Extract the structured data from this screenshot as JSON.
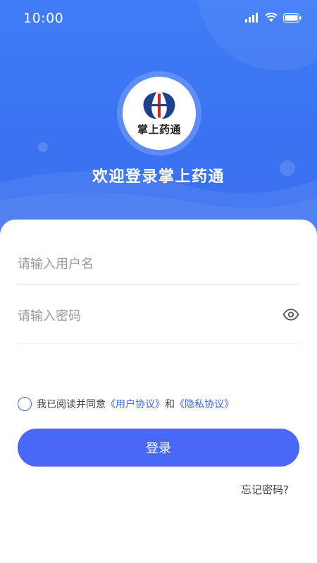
{
  "status": {
    "time": "10:00",
    "icons": [
      "signal-icon",
      "wifi-icon",
      "battery-icon"
    ]
  },
  "brand": {
    "logo_text": "掌上药通",
    "welcome": "欢迎登录掌上药通"
  },
  "form": {
    "username_placeholder": "请输入用户名",
    "password_placeholder": "请输入密码",
    "eye_icon": "eye-icon"
  },
  "agreement": {
    "prefix": "我已阅读并同意",
    "user_agreement": "《用户协议》",
    "and": "和",
    "privacy_agreement": "《隐私协议》"
  },
  "actions": {
    "login_label": "登录",
    "forgot_label": "忘记密码?"
  },
  "colors": {
    "header_blue": "#3f7df6",
    "button_blue": "#4a68f7",
    "link_blue": "#3e68f0"
  }
}
